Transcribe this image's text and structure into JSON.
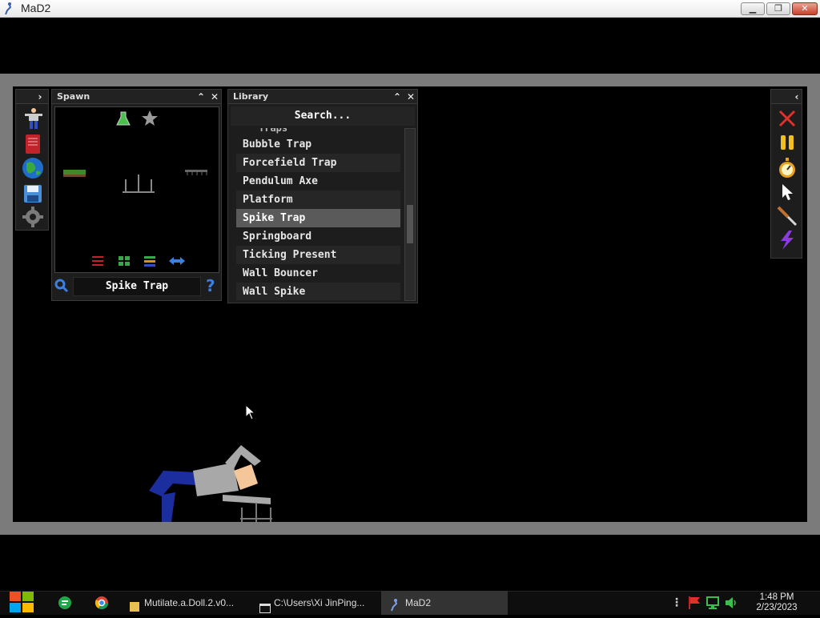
{
  "window": {
    "title": "MaD2",
    "minimize_glyph": "▁",
    "maximize_glyph": "❐",
    "close_glyph": "✕"
  },
  "spawn_panel": {
    "title": "Spawn",
    "selected_item": "Spike Trap",
    "help_glyph": "?"
  },
  "library_panel": {
    "title": "Library",
    "search_placeholder": "Search...",
    "category_partial": "Traps",
    "items": [
      "Bubble Trap",
      "Forcefield Trap",
      "Pendulum Axe",
      "Platform",
      "Spike Trap",
      "Springboard",
      "Ticking Present",
      "Wall Bouncer",
      "Wall Spike"
    ],
    "selected_index": 4
  },
  "left_toolbar": {
    "icons": [
      "ragdoll-icon",
      "book-icon",
      "globe-icon",
      "save-disk-icon",
      "gear-icon"
    ]
  },
  "right_toolbar": {
    "icons": [
      "close-x-icon",
      "pause-icon",
      "stopwatch-icon",
      "cursor-icon",
      "knife-icon",
      "lightning-icon"
    ]
  },
  "taskbar": {
    "items": [
      {
        "label": "Mutilate.a.Doll.2.v0...",
        "icon": "folder-icon"
      },
      {
        "label": "C:\\Users\\Xi JinPing...",
        "icon": "terminal-icon"
      },
      {
        "label": "MaD2",
        "icon": "mad2-app-icon"
      }
    ],
    "time": "1:48 PM",
    "date": "2/23/2023"
  },
  "colors": {
    "frame_grey": "#7b7b7b",
    "panel_bg": "#1d1d1d",
    "selected_row": "#5a5a5a",
    "doll_blue": "#1c2d9e",
    "doll_grey": "#a8a8a8",
    "doll_skin": "#f5c69a"
  }
}
